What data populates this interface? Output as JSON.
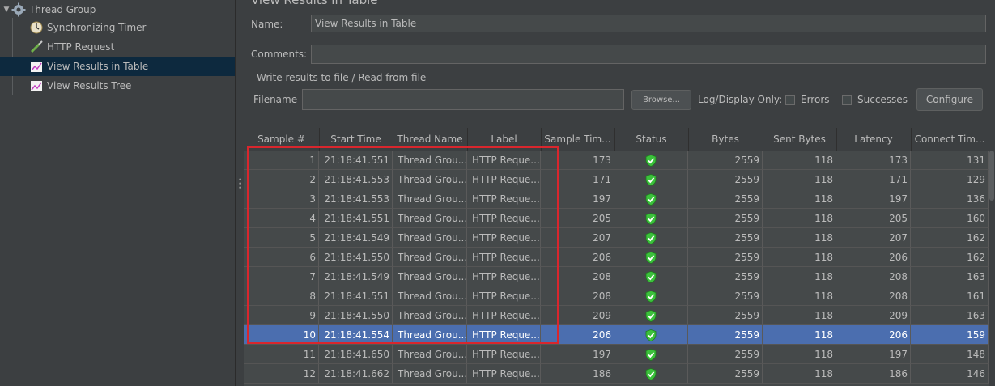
{
  "tree": {
    "items": [
      {
        "label": "Thread Group",
        "icon": "gear-icon"
      },
      {
        "label": "Synchronizing Timer",
        "icon": "timer-icon"
      },
      {
        "label": "HTTP Request",
        "icon": "pipette-icon"
      },
      {
        "label": "View Results in Table",
        "icon": "chart-icon"
      },
      {
        "label": "View Results Tree",
        "icon": "chart-icon"
      }
    ]
  },
  "panel": {
    "title": "View Results in Table",
    "name_label": "Name:",
    "name_value": "View Results in Table",
    "comments_label": "Comments:",
    "comments_value": "",
    "file_section_label": "Write results to file / Read from file",
    "filename_label": "Filename",
    "filename_value": "",
    "browse_label": "Browse...",
    "log_display_label": "Log/Display Only:",
    "errors_label": "Errors",
    "successes_label": "Successes",
    "configure_label": "Configure"
  },
  "table": {
    "columns": [
      "Sample #",
      "Start Time",
      "Thread Name",
      "Label",
      "Sample Tim...",
      "Status",
      "Bytes",
      "Sent Bytes",
      "Latency",
      "Connect Tim..."
    ],
    "selected_row": 10,
    "status_icon": "shield-check-icon",
    "status_color": "#3cc13c",
    "highlight_color": "#d9262d",
    "rows": [
      [
        "1",
        "21:18:41.551",
        "Thread Grou...",
        "HTTP Reque...",
        "173",
        "2559",
        "118",
        "173",
        "131"
      ],
      [
        "2",
        "21:18:41.553",
        "Thread Grou...",
        "HTTP Reque...",
        "171",
        "2559",
        "118",
        "171",
        "129"
      ],
      [
        "3",
        "21:18:41.553",
        "Thread Grou...",
        "HTTP Reque...",
        "197",
        "2559",
        "118",
        "197",
        "136"
      ],
      [
        "4",
        "21:18:41.551",
        "Thread Grou...",
        "HTTP Reque...",
        "205",
        "2559",
        "118",
        "205",
        "160"
      ],
      [
        "5",
        "21:18:41.549",
        "Thread Grou...",
        "HTTP Reque...",
        "207",
        "2559",
        "118",
        "207",
        "162"
      ],
      [
        "6",
        "21:18:41.550",
        "Thread Grou...",
        "HTTP Reque...",
        "206",
        "2559",
        "118",
        "206",
        "162"
      ],
      [
        "7",
        "21:18:41.549",
        "Thread Grou...",
        "HTTP Reque...",
        "208",
        "2559",
        "118",
        "208",
        "163"
      ],
      [
        "8",
        "21:18:41.551",
        "Thread Grou...",
        "HTTP Reque...",
        "208",
        "2559",
        "118",
        "208",
        "161"
      ],
      [
        "9",
        "21:18:41.550",
        "Thread Grou...",
        "HTTP Reque...",
        "209",
        "2559",
        "118",
        "209",
        "163"
      ],
      [
        "10",
        "21:18:41.554",
        "Thread Grou...",
        "HTTP Reque...",
        "206",
        "2559",
        "118",
        "206",
        "159"
      ],
      [
        "11",
        "21:18:41.650",
        "Thread Grou...",
        "HTTP Reque...",
        "197",
        "2559",
        "118",
        "197",
        "148"
      ],
      [
        "12",
        "21:18:41.662",
        "Thread Grou...",
        "HTTP Reque...",
        "186",
        "2559",
        "118",
        "186",
        "146"
      ]
    ]
  }
}
